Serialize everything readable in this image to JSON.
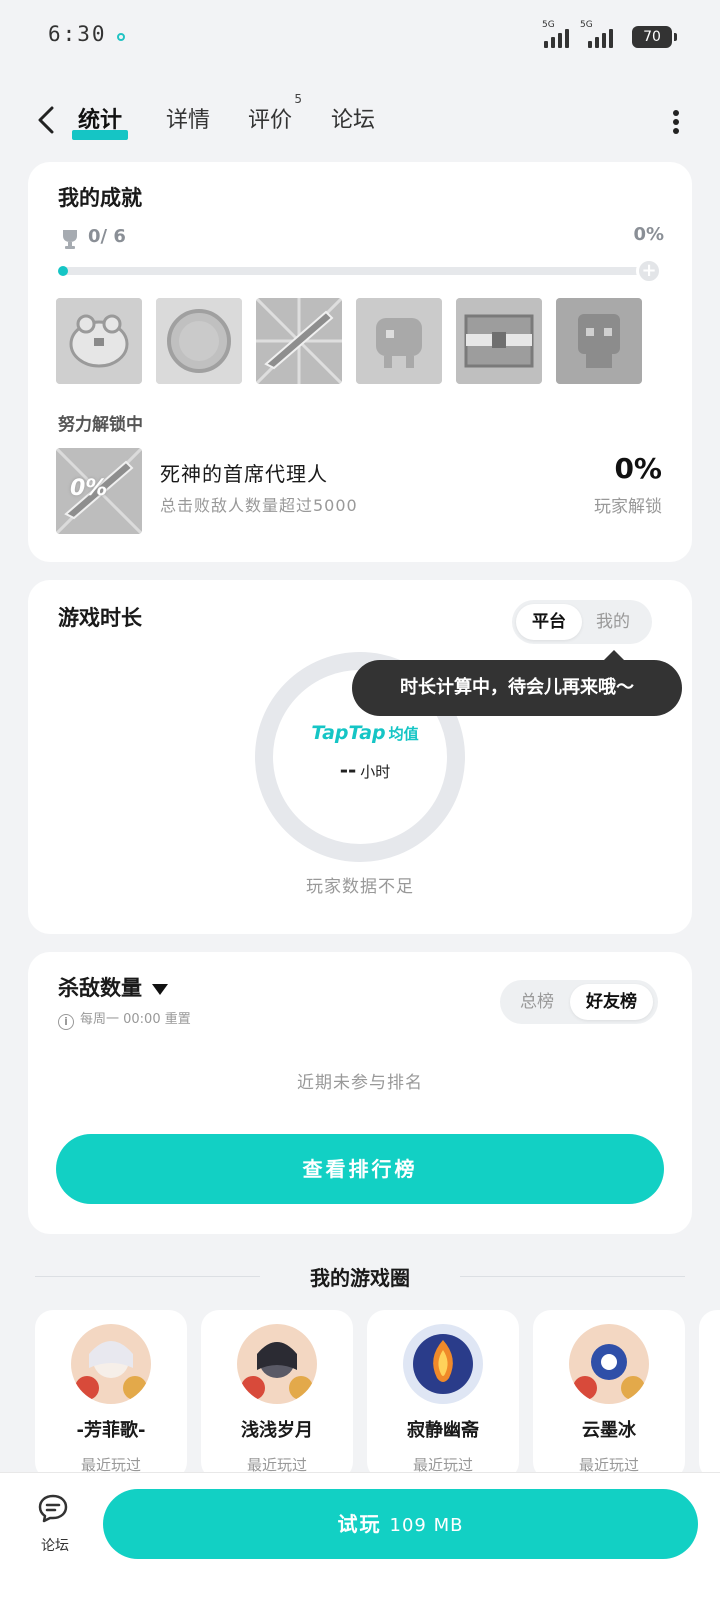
{
  "status_bar": {
    "time": "6:30",
    "network_tag_1": "5G",
    "network_tag_2": "5G",
    "battery": "70"
  },
  "nav": {
    "tabs": [
      {
        "label": "统计",
        "active": true
      },
      {
        "label": "详情",
        "active": false
      },
      {
        "label": "评价",
        "badge": "5",
        "active": false
      },
      {
        "label": "论坛",
        "active": false
      }
    ]
  },
  "achievements": {
    "title": "我的成就",
    "count": "0/ 6",
    "percent": "0%",
    "progress": 0,
    "badges": [
      "frog-badge",
      "coin-badge",
      "sword-badge",
      "creature-badge",
      "chest-badge",
      "skull-badge"
    ],
    "unlocking_label": "努力解锁中",
    "current": {
      "thumb_text": "0%",
      "name": "死神的首席代理人",
      "desc": "总击败敌人数量超过5000",
      "percent": "0%",
      "sub": "玩家解锁"
    }
  },
  "game_time": {
    "title": "游戏时长",
    "toggle": [
      {
        "label": "平台",
        "on": true
      },
      {
        "label": "我的",
        "on": false
      }
    ],
    "tooltip": "时长计算中，待会儿再来哦～",
    "brand": "TapTap",
    "brand_suffix": "均值",
    "value": "--",
    "unit": "小时",
    "note": "玩家数据不足"
  },
  "kills": {
    "title": "杀敌数量",
    "reset": "每周一 00:00 重置",
    "toggle": [
      {
        "label": "总榜",
        "on": false
      },
      {
        "label": "好友榜",
        "on": true
      }
    ],
    "empty": "近期未参与排名",
    "button": "查看排行榜"
  },
  "game_circle": {
    "title": "我的游戏圈",
    "friends": [
      {
        "name": "-芳菲歌-",
        "sub": "最近玩过"
      },
      {
        "name": "浅浅岁月",
        "sub": "最近玩过"
      },
      {
        "name": "寂静幽斋",
        "sub": "最近玩过"
      },
      {
        "name": "云墨冰",
        "sub": "最近玩过"
      }
    ]
  },
  "bottom": {
    "forum_label": "论坛",
    "play_label": "试玩",
    "play_size": "109 MB"
  },
  "colors": {
    "accent": "#12d0c4",
    "tooltip": "#333333",
    "background": "#f2f3f5"
  }
}
